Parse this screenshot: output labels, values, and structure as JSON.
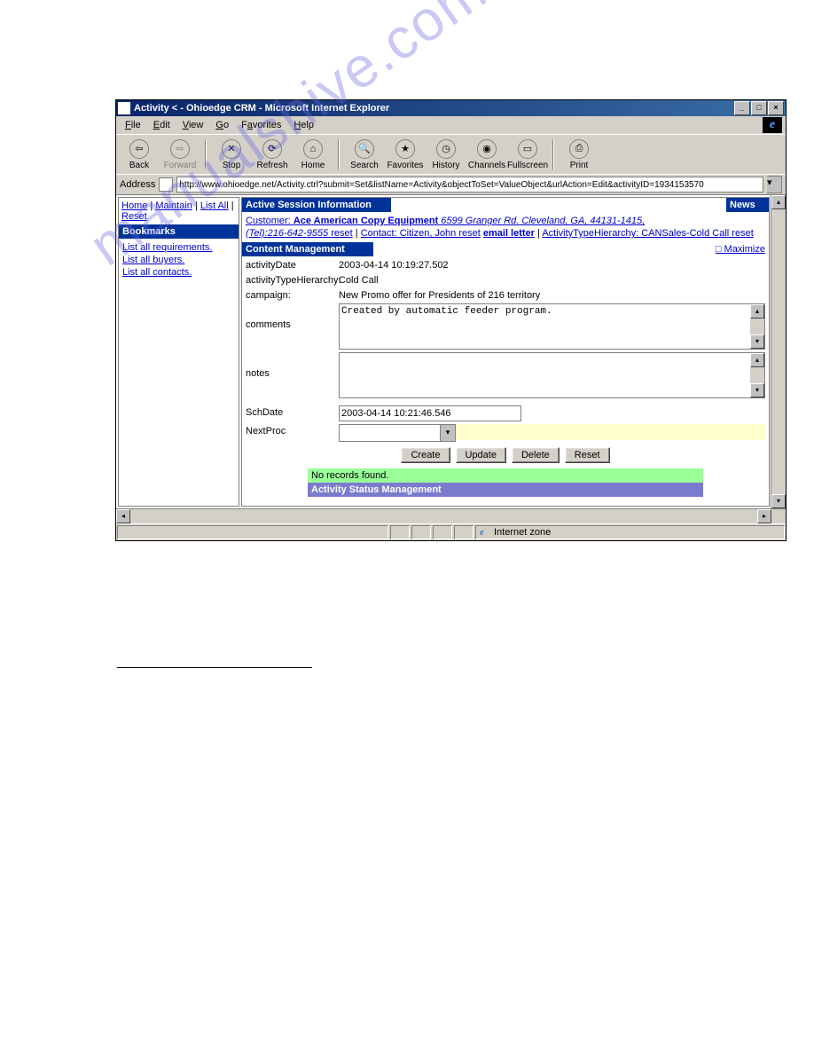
{
  "window": {
    "title": "Activity < - Ohioedge CRM - Microsoft Internet Explorer"
  },
  "menu": {
    "file": "File",
    "edit": "Edit",
    "view": "View",
    "go": "Go",
    "favorites": "Favorites",
    "help": "Help"
  },
  "toolbar": {
    "back": "Back",
    "forward": "Forward",
    "stop": "Stop",
    "refresh": "Refresh",
    "home": "Home",
    "search": "Search",
    "favorites": "Favorites",
    "history": "History",
    "channels": "Channels",
    "fullscreen": "Fullscreen",
    "print": "Print"
  },
  "address": {
    "label": "Address",
    "value": "http://www.ohioedge.net/Activity.ctrl?submit=Set&listName=Activity&objectToSet=ValueObject&urlAction=Edit&activityID=1934153570"
  },
  "sidebar": {
    "topnav": {
      "home": "Home",
      "maintain": "Maintain",
      "listall": "List All",
      "reset": "Reset"
    },
    "header": "Bookmarks",
    "links": {
      "req": "List all requirements.",
      "buyers": "List all buyers.",
      "contacts": "List all contacts."
    }
  },
  "session": {
    "header": "Active Session Information",
    "news": "News",
    "customer_label": "Customer:",
    "customer_name": "Ace American Copy Equipment",
    "customer_addr": "6599 Granger Rd. Cleveland, GA, 44131-1415,",
    "tel_label": "(Tel):",
    "tel": "216-642-9555",
    "reset": "reset",
    "contact_label": "Contact: Citizen, John reset",
    "email_letter": "email letter",
    "ath_label": "ActivityTypeHierarchy: CANSales-Cold Call reset"
  },
  "content": {
    "header": "Content Management",
    "maximize": "Maximize",
    "fields": {
      "activityDate_label": "activityDate",
      "activityDate_value": "2003-04-14 10:19:27.502",
      "ath_label": "activityTypeHierarchy:",
      "ath_value": "Cold Call",
      "campaign_label": "campaign:",
      "campaign_value": "New Promo offer for Presidents of 216 territory",
      "comments_label": "comments",
      "comments_value": "Created by automatic feeder program.",
      "notes_label": "notes",
      "notes_value": "",
      "schdate_label": "SchDate",
      "schdate_value": "2003-04-14 10:21:46.546",
      "nextproc_label": "NextProc"
    },
    "buttons": {
      "create": "Create",
      "update": "Update",
      "delete": "Delete",
      "reset": "Reset"
    },
    "no_records": "No records found.",
    "status_mgmt": "Activity Status Management"
  },
  "statusbar": {
    "zone": "Internet zone"
  },
  "watermark": "manualshive.com"
}
